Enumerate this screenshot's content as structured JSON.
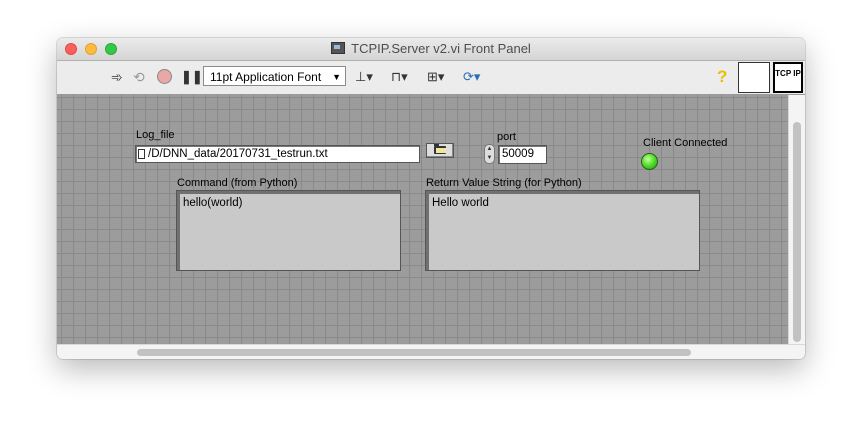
{
  "window": {
    "title": "TCPIP.Server v2.vi Front Panel"
  },
  "toolbar": {
    "run_icon": "run-arrow-icon",
    "run_continuously_icon": "run-continuously-icon",
    "abort_icon": "abort-icon",
    "pause_icon": "pause-icon",
    "font_select_value": "11pt Application Font",
    "align_icon": "align-objects-icon",
    "distribute_icon": "distribute-objects-icon",
    "resize_icon": "resize-objects-icon",
    "reorder_icon": "reorder-icon",
    "help_label": "?",
    "vi_icon_text": "TCP IP"
  },
  "panel": {
    "log_file": {
      "label": "Log_file",
      "value": "/D/DNN_data/20170731_testrun.txt"
    },
    "port": {
      "label": "port",
      "value": "50009"
    },
    "client_connected": {
      "label": "Client Connected",
      "state": "on",
      "color": "#3fd11f"
    },
    "command": {
      "label": "Command (from Python)",
      "value": "hello(world)"
    },
    "return_value": {
      "label": "Return Value String (for Python)",
      "value": "Hello world"
    }
  }
}
